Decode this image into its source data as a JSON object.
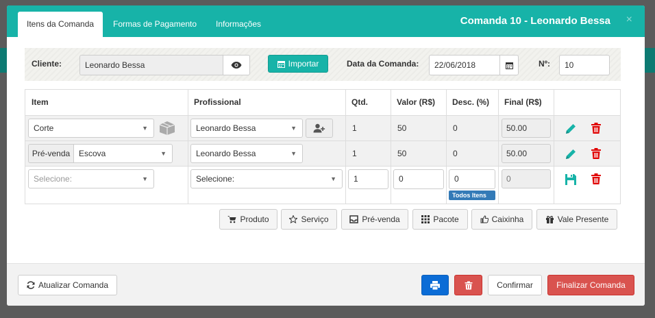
{
  "tabs": [
    {
      "label": "Itens da Comanda"
    },
    {
      "label": "Formas de Pagamento"
    },
    {
      "label": "Informações"
    }
  ],
  "modal_title": "Comanda 10 - Leonardo Bessa",
  "close_glyph": "×",
  "client": {
    "label": "Cliente:",
    "value": "Leonardo Bessa",
    "import_label": "Importar",
    "date_label": "Data da Comanda:",
    "date_value": "22/06/2018",
    "number_label": "Nº:",
    "number_value": "10"
  },
  "table": {
    "headers": {
      "item": "Item",
      "profissional": "Profissional",
      "qtd": "Qtd.",
      "valor": "Valor (R$)",
      "desc": "Desc. (%)",
      "final": "Final (R$)"
    },
    "rows": [
      {
        "item": "Corte",
        "prefix": "",
        "profissional": "Leonardo Bessa",
        "qtd": "1",
        "valor": "50",
        "desc": "0",
        "final": "50.00"
      },
      {
        "item": "Escova",
        "prefix": "Pré-venda",
        "profissional": "Leonardo Bessa",
        "qtd": "1",
        "valor": "50",
        "desc": "0",
        "final": "50.00"
      }
    ],
    "new_row": {
      "item_placeholder": "Selecione:",
      "profissional_placeholder": "Selecione:",
      "qtd": "1",
      "valor": "0",
      "desc": "0",
      "final": "0",
      "todos_itens": "Todos Itens"
    }
  },
  "add_buttons": [
    {
      "label": "Produto"
    },
    {
      "label": "Serviço"
    },
    {
      "label": "Pré-venda"
    },
    {
      "label": "Pacote"
    },
    {
      "label": "Caixinha"
    },
    {
      "label": "Vale Presente"
    }
  ],
  "footer": {
    "refresh_label": "Atualizar Comanda",
    "confirm_label": "Confirmar",
    "finalize_label": "Finalizar Comanda"
  },
  "colors": {
    "accent": "#17b3a8",
    "edit": "#17b3a8",
    "delete": "#e00000",
    "print": "#0b6cd6",
    "danger": "#d9534f"
  }
}
